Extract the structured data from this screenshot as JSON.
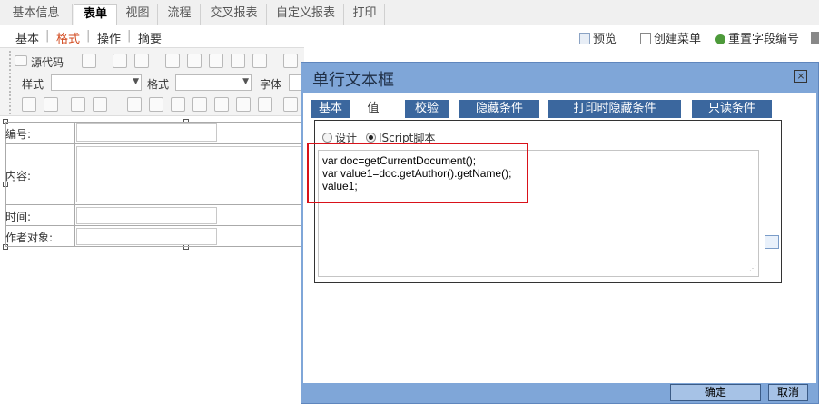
{
  "top_tabs": [
    "基本信息",
    "表单",
    "视图",
    "流程",
    "交叉报表",
    "自定义报表",
    "打印"
  ],
  "sub_nav": [
    "基本",
    "格式",
    "操作",
    "摘要"
  ],
  "toolbar_links": {
    "preview": "预览",
    "create_menu": "创建菜单",
    "reset_field": "重置字段编号"
  },
  "editor_toolbar": {
    "source": "源代码",
    "style": "样式",
    "format": "格式",
    "font": "字体"
  },
  "form": {
    "rows": [
      {
        "label": "编号:"
      },
      {
        "label": "内容:"
      },
      {
        "label": "时间:"
      },
      {
        "label": "作者对象:"
      }
    ]
  },
  "dialog": {
    "title": "单行文本框",
    "close": "×",
    "tabs": [
      "基本",
      "值",
      "校验",
      "隐藏条件",
      "打印时隐藏条件",
      "只读条件"
    ],
    "mode_design": "设计",
    "mode_script": "IScript脚本",
    "code_lines": [
      "var doc=getCurrentDocument();",
      "var value1=doc.getAuthor().getName();",
      "value1;"
    ],
    "ok": "确定",
    "cancel": "取消"
  },
  "colors": {
    "accent": "#3b679e",
    "highlight": "#d9121a",
    "active_nav": "#d24a1f"
  }
}
